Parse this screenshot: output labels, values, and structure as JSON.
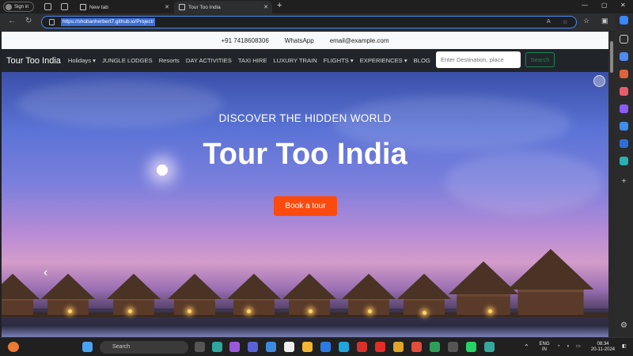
{
  "tabs": {
    "signin_label": "Sign in",
    "items": [
      {
        "label": "New tab",
        "active": false
      },
      {
        "label": "Tour Too India",
        "active": true
      }
    ]
  },
  "address_bar": {
    "url": "https://shobanherbert7.github.io/Project/"
  },
  "site": {
    "contact": {
      "phone": "+91 7418608306",
      "whatsapp": "WhatsApp",
      "email": "email@example.com"
    },
    "brand": "Tour Too India",
    "nav": [
      {
        "label": "Holidays",
        "dropdown": true
      },
      {
        "label": "JUNGLE LODGES",
        "dropdown": false
      },
      {
        "label": "Resorts",
        "dropdown": false
      },
      {
        "label": "DAY ACTIVITIES",
        "dropdown": false
      },
      {
        "label": "TAXI HIRE",
        "dropdown": false
      },
      {
        "label": "LUXURY TRAIN",
        "dropdown": false
      },
      {
        "label": "FLIGHTS",
        "dropdown": true
      },
      {
        "label": "EXPERIENCES",
        "dropdown": true
      },
      {
        "label": "BLOG",
        "dropdown": false
      }
    ],
    "search": {
      "placeholder": "Enter Destination, place",
      "button": "Search"
    },
    "hero": {
      "subtitle": "DISCOVER THE HIDDEN WORLD",
      "title": "Tour Too India",
      "cta": "Book a tour",
      "colors": {
        "cta": "#fd4a0f",
        "navbar": "#212529",
        "search_button": "#198754"
      }
    }
  },
  "taskbar": {
    "search_label": "Search",
    "language": "ENG",
    "region": "IN",
    "time": "08:34",
    "date": "20-11-2024"
  }
}
